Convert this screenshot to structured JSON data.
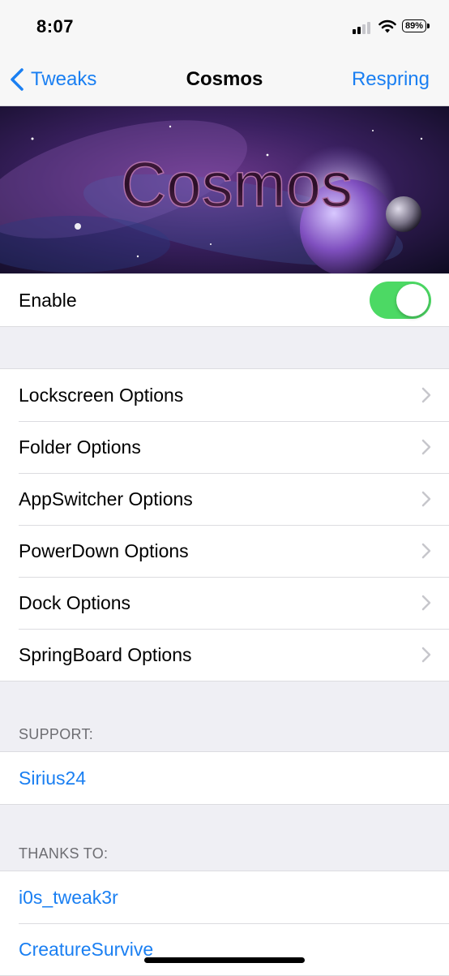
{
  "status_bar": {
    "time": "8:07",
    "battery_percent": "89%",
    "signal_bars_active": 2,
    "signal_bars_total": 4
  },
  "navbar": {
    "back_label": "Tweaks",
    "title": "Cosmos",
    "action_label": "Respring"
  },
  "banner": {
    "logo_text": "Cosmos"
  },
  "enable_row": {
    "label": "Enable",
    "enabled": true
  },
  "options": [
    {
      "label": "Lockscreen Options"
    },
    {
      "label": "Folder Options"
    },
    {
      "label": "AppSwitcher Options"
    },
    {
      "label": "PowerDown Options"
    },
    {
      "label": "Dock Options"
    },
    {
      "label": "SpringBoard Options"
    }
  ],
  "support": {
    "header": "SUPPORT:",
    "items": [
      {
        "label": "Sirius24"
      }
    ]
  },
  "thanks": {
    "header": "THANKS TO:",
    "items": [
      {
        "label": "i0s_tweak3r"
      },
      {
        "label": "CreatureSurvive"
      }
    ]
  },
  "colors": {
    "accent": "#1a7ff2",
    "toggle_on": "#4cd964",
    "background": "#efeff4"
  }
}
